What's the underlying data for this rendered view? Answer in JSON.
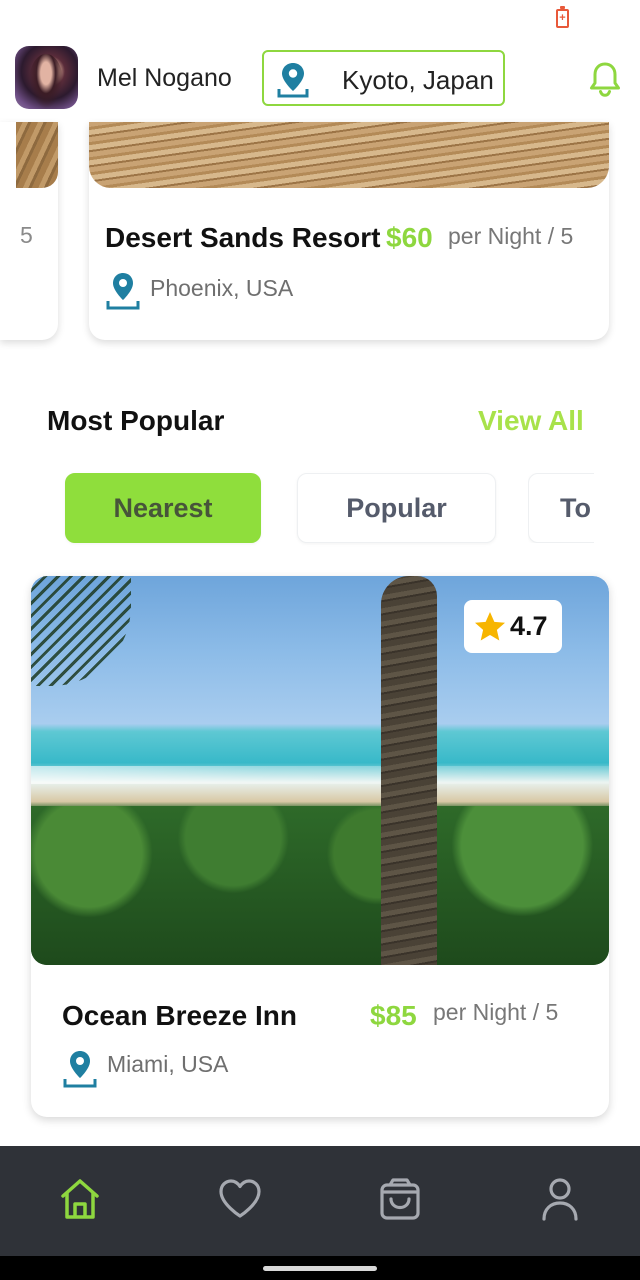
{
  "header": {
    "username": "Mel Nogano",
    "location": "Kyoto, Japan"
  },
  "featured_peek": {
    "text": "5"
  },
  "featured": {
    "title": "Desert Sands Resort",
    "price": "$60",
    "per": "per Night / 5",
    "location": "Phoenix, USA"
  },
  "section": {
    "title": "Most Popular",
    "view_all": "View All"
  },
  "tabs": [
    {
      "label": "Nearest",
      "active": true
    },
    {
      "label": "Popular",
      "active": false
    },
    {
      "label": "To",
      "active": false
    }
  ],
  "popular_card": {
    "rating": "4.7",
    "title": "Ocean Breeze Inn",
    "price": "$85",
    "per": "per Night / 5",
    "location": "Miami, USA"
  },
  "nav": {
    "items": [
      {
        "icon": "home-icon",
        "active": true
      },
      {
        "icon": "heart-icon",
        "active": false
      },
      {
        "icon": "shopping-bag-icon",
        "active": false
      },
      {
        "icon": "profile-icon",
        "active": false
      }
    ]
  },
  "colors": {
    "accent": "#8ed73f",
    "pin": "#1f7fa1",
    "navbar": "#2f3238"
  }
}
